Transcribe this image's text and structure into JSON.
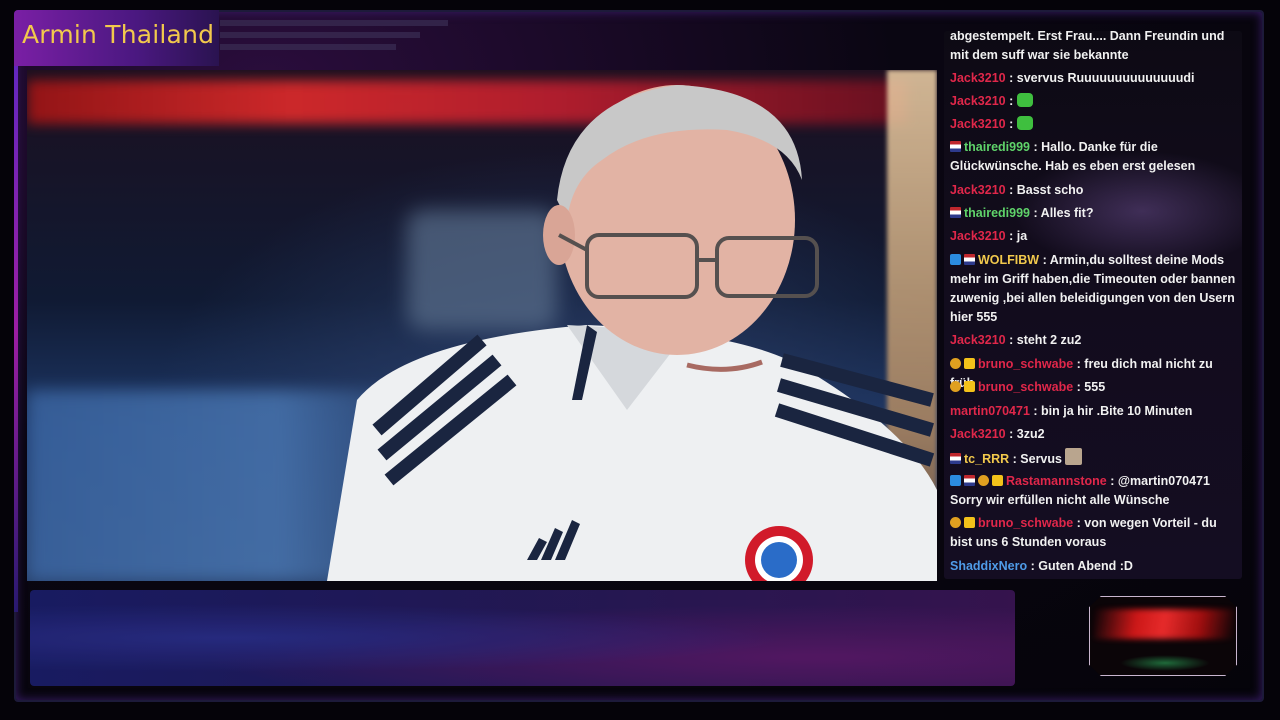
{
  "stream": {
    "title": "Armin Thailand"
  },
  "colors": {
    "title_gold": "#f2c94c",
    "user_red": "#e0274a",
    "user_green": "#5fd36a",
    "user_gold": "#f2c94c",
    "user_blue": "#4f9be8"
  },
  "chat": {
    "messages": [
      {
        "user": "",
        "text": "abgestempelt. Erst Frau.... Dann Freundin und mit dem suff war sie bekannte"
      },
      {
        "user": "Jack3210",
        "text": ": svervus Ruuuuuuuuuuuuuudi"
      },
      {
        "user": "Jack3210",
        "text": ":",
        "emote": "green-emote"
      },
      {
        "user": "Jack3210",
        "text": ":",
        "emote": "green-emote"
      },
      {
        "user": "thairedi999",
        "text": ": Hallo. Danke für die Glückwünsche. Hab es eben erst gelesen",
        "badges": [
          "flag"
        ]
      },
      {
        "user": "Jack3210",
        "text": ": Basst scho"
      },
      {
        "user": "thairedi999",
        "text": ": Alles fit?",
        "badges": [
          "flag"
        ]
      },
      {
        "user": "Jack3210",
        "text": ": ja"
      },
      {
        "user": "WOLFIBW",
        "text": ": Armin,du solltest deine Mods mehr im Griff haben,die Timeouten oder bannen zuwenig ,bei allen beleidigungen von den Usern hier 555",
        "badges": [
          "mod",
          "flag"
        ]
      },
      {
        "user": "Jack3210",
        "text": ": steht 2 zu2"
      },
      {
        "user": "bruno_schwabe",
        "text": ": freu dich mal nicht zu früh",
        "badges": [
          "sub",
          "crown"
        ]
      },
      {
        "user": "bruno_schwabe",
        "text": ": 555",
        "badges": [
          "sub",
          "crown"
        ]
      },
      {
        "user": "martin070471",
        "text": ": bin ja hir .Bite 10 Minuten"
      },
      {
        "user": "Jack3210",
        "text": ": 3zu2"
      },
      {
        "user": "tc_RRR",
        "text": ": Servus",
        "badges": [
          "flag"
        ],
        "emote": "face-emote"
      },
      {
        "user": "Rastamannstone",
        "text": ": @martin070471 Sorry wir erfüllen nicht alle Wünsche",
        "badges": [
          "mod",
          "flag",
          "sub",
          "crown"
        ]
      },
      {
        "user": "bruno_schwabe",
        "text": ": von wegen Vorteil - du bist uns 6 Stunden voraus",
        "badges": [
          "sub",
          "crown"
        ]
      },
      {
        "user": "ShaddixNero",
        "text": ": Guten Abend :D"
      }
    ]
  }
}
